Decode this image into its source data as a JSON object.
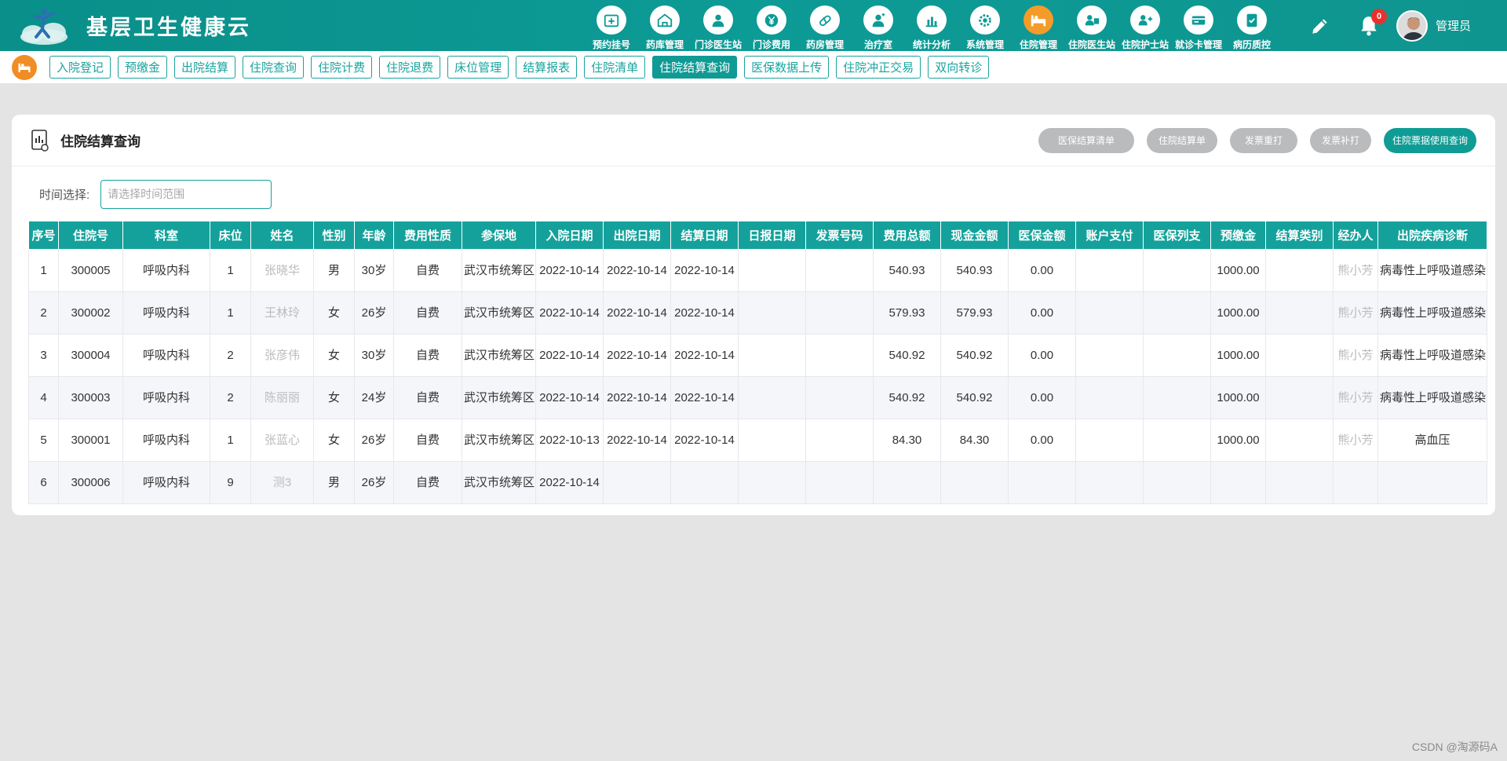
{
  "app": {
    "title": "基层卫生健康云"
  },
  "colors": {
    "brand": "#0d9b96",
    "active_nav": "#f49c2a",
    "badge": "#e8312f"
  },
  "nav": {
    "items": [
      {
        "label": "预约挂号",
        "icon": "calendar-plus-icon"
      },
      {
        "label": "药库管理",
        "icon": "warehouse-icon"
      },
      {
        "label": "门诊医生站",
        "icon": "doctor-icon"
      },
      {
        "label": "门诊费用",
        "icon": "yen-icon"
      },
      {
        "label": "药房管理",
        "icon": "pill-icon"
      },
      {
        "label": "治疗室",
        "icon": "nurse-icon"
      },
      {
        "label": "统计分析",
        "icon": "bar-chart-icon"
      },
      {
        "label": "系统管理",
        "icon": "gear-icon"
      },
      {
        "label": "住院管理",
        "icon": "hospital-bed-icon"
      },
      {
        "label": "住院医生站",
        "icon": "doctor-card-icon"
      },
      {
        "label": "住院护士站",
        "icon": "nurse-card-icon"
      },
      {
        "label": "就诊卡管理",
        "icon": "card-icon"
      },
      {
        "label": "病历质控",
        "icon": "record-check-icon"
      }
    ],
    "active_index": 8
  },
  "header": {
    "notifications": "0",
    "username": "管理员"
  },
  "subnav": {
    "tabs": [
      "入院登记",
      "预缴金",
      "出院结算",
      "住院查询",
      "住院计费",
      "住院退费",
      "床位管理",
      "结算报表",
      "住院清单",
      "住院结算查询",
      "医保数据上传",
      "住院冲正交易",
      "双向转诊"
    ],
    "active_index": 9
  },
  "page": {
    "title": "住院结算查询",
    "buttons": [
      "医保结算清单",
      "住院结算单",
      "发票重打",
      "发票补打",
      "住院票据使用查询"
    ],
    "filter_label": "时间选择:",
    "filter_placeholder": "请选择时间范围"
  },
  "table": {
    "columns": [
      "序号",
      "住院号",
      "科室",
      "床位",
      "姓名",
      "性别",
      "年龄",
      "费用性质",
      "参保地",
      "入院日期",
      "出院日期",
      "结算日期",
      "日报日期",
      "发票号码",
      "费用总额",
      "现金金额",
      "医保金额",
      "账户支付",
      "医保列支",
      "预缴金",
      "结算类别",
      "经办人",
      "出院疾病诊断"
    ],
    "rows": [
      [
        "1",
        "300005",
        "呼吸内科",
        "1",
        "张晓华",
        "男",
        "30岁",
        "自费",
        "武汉市统筹区",
        "2022-10-14",
        "2022-10-14",
        "2022-10-14",
        "",
        "",
        "540.93",
        "540.93",
        "0.00",
        "",
        "",
        "1000.00",
        "",
        "熊小芳",
        "病毒性上呼吸道感染"
      ],
      [
        "2",
        "300002",
        "呼吸内科",
        "1",
        "王林玲",
        "女",
        "26岁",
        "自费",
        "武汉市统筹区",
        "2022-10-14",
        "2022-10-14",
        "2022-10-14",
        "",
        "",
        "579.93",
        "579.93",
        "0.00",
        "",
        "",
        "1000.00",
        "",
        "熊小芳",
        "病毒性上呼吸道感染"
      ],
      [
        "3",
        "300004",
        "呼吸内科",
        "2",
        "张彦伟",
        "女",
        "30岁",
        "自费",
        "武汉市统筹区",
        "2022-10-14",
        "2022-10-14",
        "2022-10-14",
        "",
        "",
        "540.92",
        "540.92",
        "0.00",
        "",
        "",
        "1000.00",
        "",
        "熊小芳",
        "病毒性上呼吸道感染"
      ],
      [
        "4",
        "300003",
        "呼吸内科",
        "2",
        "陈丽丽",
        "女",
        "24岁",
        "自费",
        "武汉市统筹区",
        "2022-10-14",
        "2022-10-14",
        "2022-10-14",
        "",
        "",
        "540.92",
        "540.92",
        "0.00",
        "",
        "",
        "1000.00",
        "",
        "熊小芳",
        "病毒性上呼吸道感染"
      ],
      [
        "5",
        "300001",
        "呼吸内科",
        "1",
        "张蓝心",
        "女",
        "26岁",
        "自费",
        "武汉市统筹区",
        "2022-10-13",
        "2022-10-14",
        "2022-10-14",
        "",
        "",
        "84.30",
        "84.30",
        "0.00",
        "",
        "",
        "1000.00",
        "",
        "熊小芳",
        "高血压"
      ],
      [
        "6",
        "300006",
        "呼吸内科",
        "9",
        "测3",
        "男",
        "26岁",
        "自费",
        "武汉市统筹区",
        "2022-10-14",
        "",
        "",
        "",
        "",
        "",
        "",
        "",
        "",
        "",
        "",
        "",
        "",
        ""
      ]
    ]
  },
  "watermark": "CSDN @淘源码A"
}
